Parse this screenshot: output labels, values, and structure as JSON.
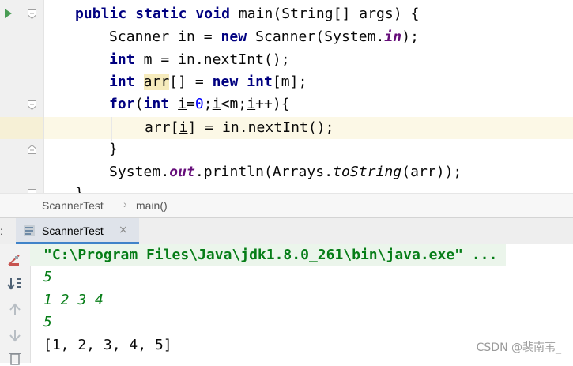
{
  "editor": {
    "lines": {
      "l1": {
        "p1": "public static void ",
        "p2": "main(String[] args) {"
      },
      "l2": {
        "p1": "Scanner in = ",
        "p2": "new ",
        "p3": "Scanner(System.",
        "p4": "in",
        "p5": ");"
      },
      "l3": {
        "p1": "int ",
        "p2": "m = in.nextInt();"
      },
      "l4": {
        "p1": "int ",
        "p2": "arr",
        "p3": "[] = ",
        "p4": "new ",
        "p5": "int",
        "p6": "[m];"
      },
      "l5": {
        "p1": "for",
        "p2": "(",
        "p3": "int ",
        "p4": "i",
        "p5": "=",
        "p6": "0",
        "p7": ";",
        "p8": "i",
        "p9": "<m;",
        "p10": "i",
        "p11": "++){"
      },
      "l6": {
        "p1": "arr[",
        "p2": "i",
        "p3": "] = in.nextInt();"
      },
      "l7": {
        "p1": "}"
      },
      "l8": {
        "p1": "System.",
        "p2": "out",
        "p3": ".println(Arrays.",
        "p4": "toString",
        "p5": "(arr));"
      },
      "l9": {
        "p1": "}"
      }
    }
  },
  "breadcrumb": {
    "items": [
      "ScannerTest",
      "main()"
    ],
    "separator": "›"
  },
  "run_panel": {
    "left_label": ":",
    "tab_label": "ScannerTest",
    "close_glyph": "×"
  },
  "console": {
    "command": "\"C:\\Program Files\\Java\\jdk1.8.0_261\\bin\\java.exe\" ...",
    "input1": "5",
    "input2": "1 2 3 4",
    "input3": "5",
    "output": "[1, 2, 3, 4, 5]"
  },
  "watermark": "CSDN @裴南苇_",
  "icons": {
    "run": "run-gutter-icon",
    "fold": "fold-marker-icon",
    "class": "class-icon",
    "stop": "stop-icon",
    "sort": "sort-icon",
    "up": "up-arrow-icon",
    "down": "down-arrow-icon",
    "trash": "trash-icon"
  },
  "colors": {
    "keyword": "#000080",
    "number": "#0000ff",
    "static_field": "#660e7a",
    "console_green": "#067d17",
    "current_line": "#fcf8e6",
    "tab_underline": "#4083c9"
  }
}
